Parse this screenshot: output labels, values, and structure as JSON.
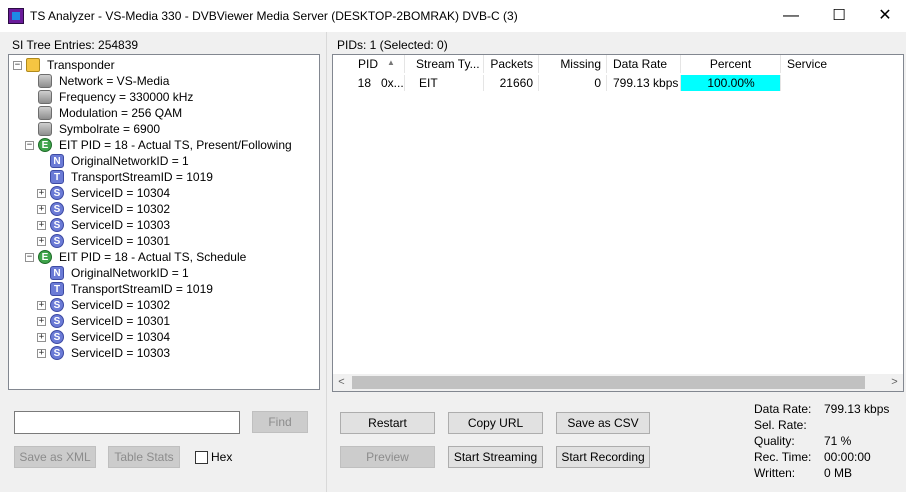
{
  "window": {
    "title": "TS Analyzer - VS-Media 330 - DVBViewer Media Server (DESKTOP-2BOMRAK) DVB-C (3)",
    "minimize": "—",
    "maximize": "☐",
    "close": "✕"
  },
  "tree": {
    "header": "SI Tree Entries: 254839",
    "root": "Transponder",
    "transponder_props": [
      "Network = VS-Media",
      "Frequency = 330000 kHz",
      "Modulation = 256 QAM",
      "Symbolrate = 6900"
    ],
    "eit1": {
      "label": "EIT PID = 18 - Actual TS, Present/Following",
      "onid": "OriginalNetworkID = 1",
      "tsid": "TransportStreamID = 1019",
      "services": [
        "ServiceID = 10304",
        "ServiceID = 10302",
        "ServiceID = 10303",
        "ServiceID = 10301"
      ]
    },
    "eit2": {
      "label": "EIT PID = 18 - Actual TS, Schedule",
      "onid": "OriginalNetworkID = 1",
      "tsid": "TransportStreamID = 1019",
      "services": [
        "ServiceID = 10302",
        "ServiceID = 10301",
        "ServiceID = 10304",
        "ServiceID = 10303"
      ]
    },
    "icons": {
      "E": "E",
      "N": "N",
      "T": "T",
      "S": "S"
    }
  },
  "search": {
    "value": "",
    "find_label": "Find"
  },
  "left_buttons": {
    "save_xml": "Save as XML",
    "table_stats": "Table Stats",
    "hex": "Hex"
  },
  "pids": {
    "header": "PIDs: 1   (Selected: 0)",
    "columns": [
      "PID",
      "Stream Ty...",
      "Packets",
      "Missing",
      "Data Rate",
      "Percent",
      "Service"
    ],
    "sort_indicator": "▲",
    "rows": [
      {
        "pid": "18",
        "hex": "0x...",
        "stream_type": "EIT",
        "packets": "21660",
        "missing": "0",
        "data_rate": "799.13 kbps",
        "percent": "100.00%",
        "percent_value": 1.0,
        "service": ""
      }
    ],
    "percent_color": "#00ffff"
  },
  "actions": {
    "restart": "Restart",
    "copy_url": "Copy URL",
    "save_csv": "Save as CSV",
    "preview": "Preview",
    "start_streaming": "Start Streaming",
    "start_recording": "Start Recording"
  },
  "stats": {
    "data_rate_label": "Data Rate:",
    "data_rate_value": "799.13 kbps",
    "sel_rate_label": "Sel. Rate:",
    "sel_rate_value": "",
    "quality_label": "Quality:",
    "quality_value": "71 %",
    "rec_time_label": "Rec. Time:",
    "rec_time_value": "00:00:00",
    "written_label": "Written:",
    "written_value": "0 MB"
  },
  "scroll": {
    "left": "<",
    "right": ">"
  }
}
